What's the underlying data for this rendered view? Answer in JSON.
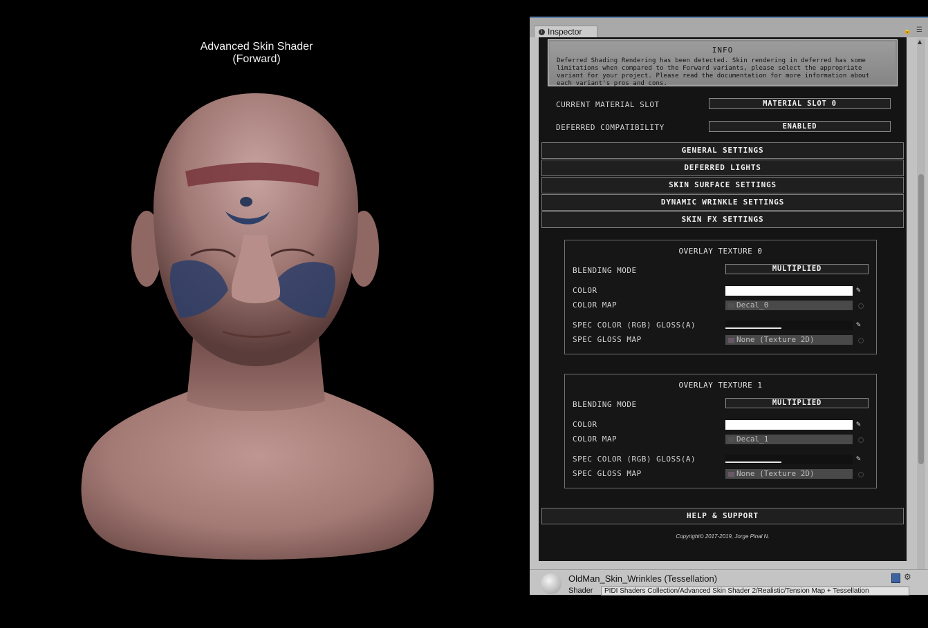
{
  "viewport": {
    "title_line1": "Advanced Skin Shader",
    "title_line2": "(Forward)"
  },
  "inspector": {
    "tab_label": "Inspector",
    "tab_icon": "info-icon",
    "info": {
      "title": "INFO",
      "text": "Deferred Shading Rendering has been detected. Skin rendering in deferred has some limitations when compared to the Forward variants, please select the appropriate variant for your project. Please read the documentation for more information about each variant's pros and cons."
    },
    "properties": [
      {
        "label": "CURRENT MATERIAL SLOT",
        "value": "MATERIAL SLOT 0"
      },
      {
        "label": "DEFERRED COMPATIBILITY",
        "value": "ENABLED"
      }
    ],
    "sections": [
      "GENERAL SETTINGS",
      "DEFERRED LIGHTS",
      "SKIN SURFACE SETTINGS",
      "DYNAMIC WRINKLE SETTINGS",
      "SKIN FX SETTINGS"
    ],
    "overlays": [
      {
        "title": "OVERLAY TEXTURE 0",
        "blending_label": "BLENDING MODE",
        "blending_value": "MULTIPLIED",
        "color_label": "COLOR",
        "color_value": "#ffffff",
        "color_map_label": "COLOR MAP",
        "color_map_value": "Decal_0",
        "spec_label": "SPEC COLOR (RGB) GLOSS(A)",
        "spec_alpha": 0.44,
        "spec_map_label": "SPEC GLOSS MAP",
        "spec_map_value": "None (Texture 2D)"
      },
      {
        "title": "OVERLAY TEXTURE 1",
        "blending_label": "BLENDING MODE",
        "blending_value": "MULTIPLIED",
        "color_label": "COLOR",
        "color_value": "#ffffff",
        "color_map_label": "COLOR MAP",
        "color_map_value": "Decal_1",
        "spec_label": "SPEC COLOR (RGB) GLOSS(A)",
        "spec_alpha": 0.44,
        "spec_map_label": "SPEC GLOSS MAP",
        "spec_map_value": "None (Texture 2D)"
      }
    ],
    "help_button": "HELP & SUPPORT",
    "copyright": "Copyright© 2017-2019,   Jorge Pinal N.",
    "material": {
      "name": "OldMan_Skin_Wrinkles (Tessellation)",
      "shader_label": "Shader",
      "shader_value": "PIDI Shaders Collection/Advanced Skin Shader 2/Realistic/Tension Map + Tessellation"
    }
  }
}
